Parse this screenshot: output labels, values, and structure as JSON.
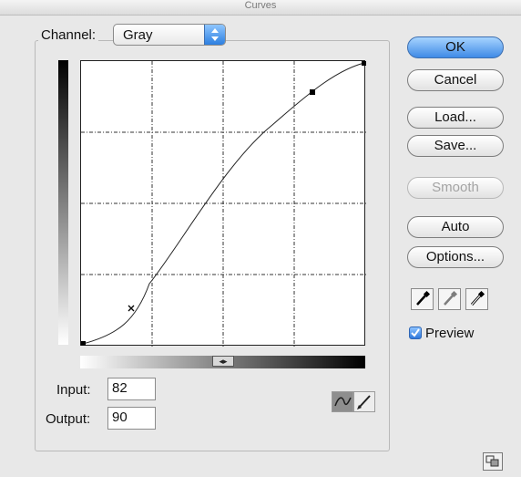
{
  "dialog": {
    "title": "Curves",
    "channel_label": "Channel:",
    "channel_value": "Gray",
    "input_label": "Input:",
    "input_value": "82",
    "output_label": "Output:",
    "output_value": "90",
    "slider_knob_glyph": "◂▸",
    "preview_label": "Preview",
    "preview_checked": true
  },
  "buttons": {
    "ok": "OK",
    "cancel": "Cancel",
    "load": "Load...",
    "save": "Save...",
    "smooth": "Smooth",
    "auto": "Auto",
    "options": "Options..."
  },
  "icons": {
    "curve_tool": "curve-icon",
    "pencil_tool": "pencil-icon",
    "black_eyedropper": "eyedropper-icon",
    "gray_eyedropper": "eyedropper-icon",
    "white_eyedropper": "eyedropper-icon",
    "resize": "resize-icon"
  },
  "colors": {
    "accent_blue": "#3f8ae6",
    "dialog_bg": "#e8e8e8"
  }
}
